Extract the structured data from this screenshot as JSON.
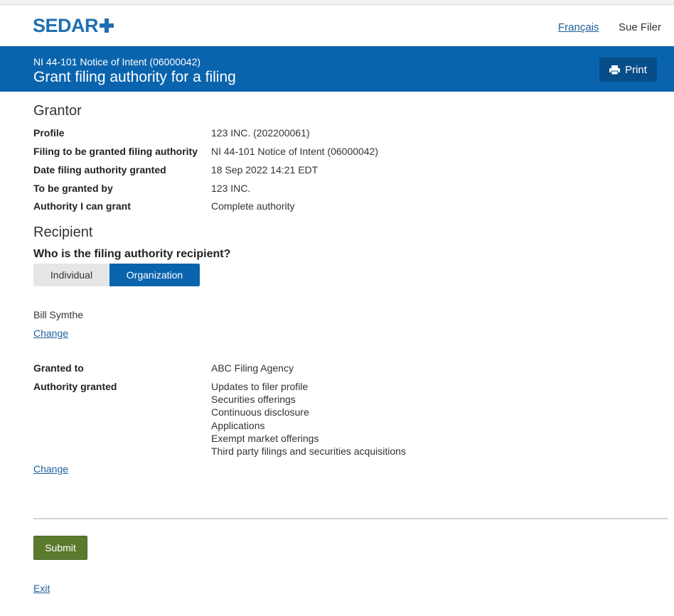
{
  "header": {
    "logo_text": "SEDAR",
    "language_link": "Français",
    "user_name": "Sue Filer"
  },
  "banner": {
    "subtitle": "NI 44-101 Notice of Intent (06000042)",
    "title": "Grant filing authority for a filing",
    "print_label": "Print"
  },
  "grantor": {
    "heading": "Grantor",
    "rows": [
      {
        "label": "Profile",
        "value": "123 INC. (202200061)"
      },
      {
        "label": "Filing to be granted filing authority",
        "value": "NI 44-101 Notice of Intent (06000042)"
      },
      {
        "label": "Date filing authority granted",
        "value": "18 Sep 2022 14:21 EDT"
      },
      {
        "label": "To be granted by",
        "value": "123 INC."
      },
      {
        "label": "Authority I can grant",
        "value": "Complete authority"
      }
    ]
  },
  "recipient": {
    "heading": "Recipient",
    "question": "Who is the filing authority recipient?",
    "toggle": {
      "individual": "Individual",
      "organization": "Organization",
      "selected": "Organization"
    },
    "person_name": "Bill Symthe",
    "change_label": "Change",
    "granted_to_label": "Granted to",
    "granted_to_value": "ABC Filing Agency",
    "authority_granted_label": "Authority granted",
    "authority_granted_items": [
      "Updates to filer profile",
      "Securities offerings",
      "Continuous disclosure",
      "Applications",
      "Exempt market offerings",
      "Third party filings and securities acquisitions"
    ],
    "change_label_2": "Change"
  },
  "footer": {
    "submit_label": "Submit",
    "exit_label": "Exit"
  },
  "colors": {
    "brand_blue": "#0a64ad",
    "submit_green": "#5c7a2e",
    "link_blue": "#1f5f9e"
  }
}
